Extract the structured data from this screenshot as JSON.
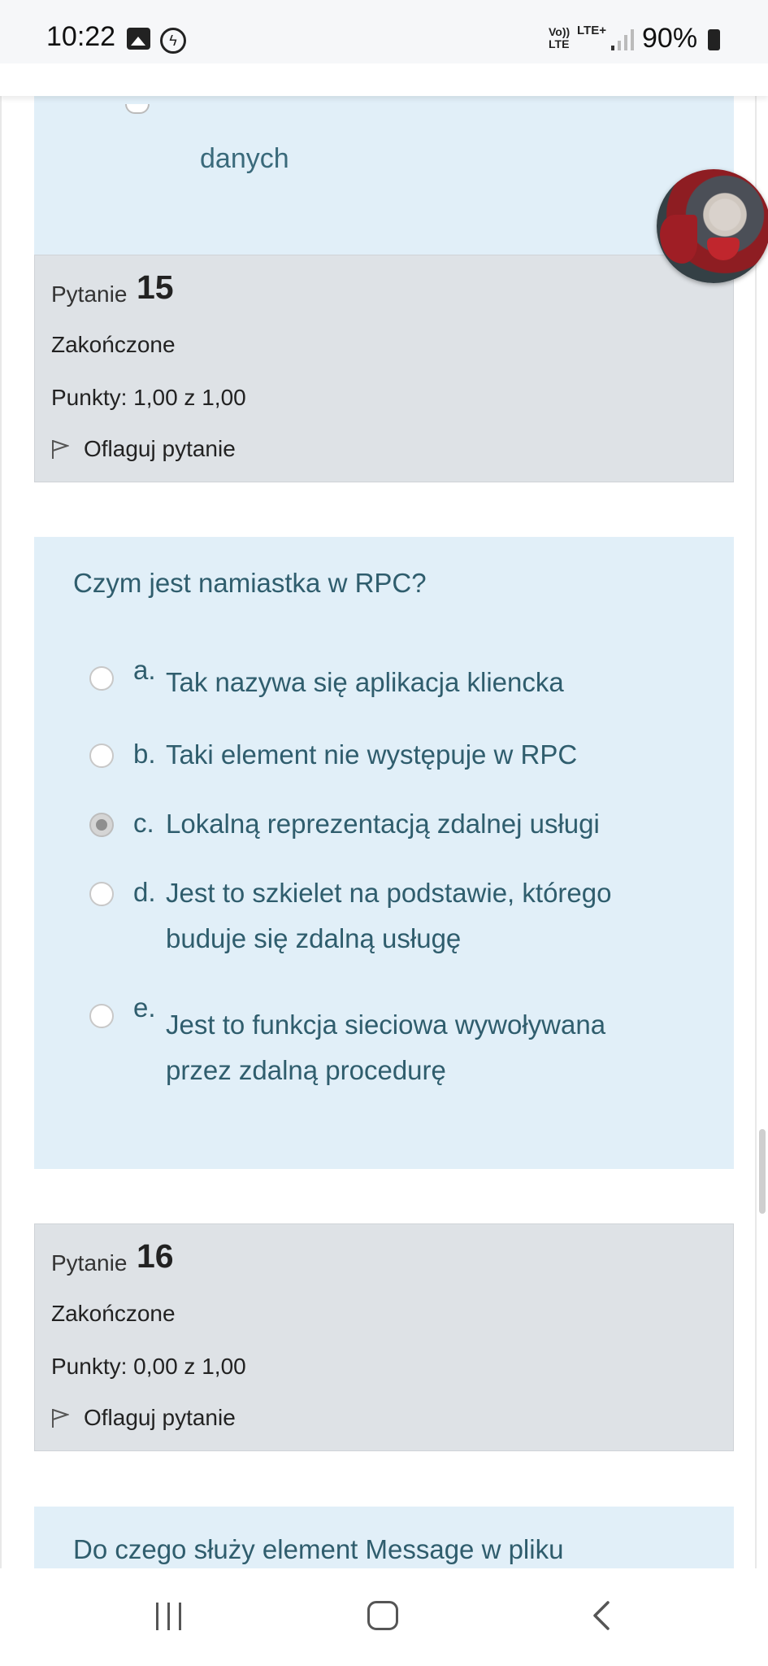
{
  "status_bar": {
    "time": "10:22",
    "notification_icons": [
      "gallery-icon",
      "messenger-icon"
    ],
    "volte": "Vo)) LTE",
    "network": "LTE+",
    "battery": "90%"
  },
  "previous_answer": {
    "text": "danych"
  },
  "q15": {
    "label": "Pytanie",
    "number": "15",
    "state": "Zakończone",
    "grade": "Punkty: 1,00 z 1,00",
    "flag": "Oflaguj pytanie",
    "question": "Czym jest namiastka w RPC?",
    "answers": [
      {
        "letter": "a.",
        "text": "Tak nazywa się aplikacja kliencka",
        "selected": false
      },
      {
        "letter": "b.",
        "text": "Taki element nie występuje w RPC",
        "selected": false
      },
      {
        "letter": "c.",
        "text": "Lokalną reprezentacją zdalnej usługi",
        "selected": true
      },
      {
        "letter": "d.",
        "text_line1": "Jest to szkielet na podstawie, którego",
        "text_line2": "buduje się zdalną usługę",
        "selected": false
      },
      {
        "letter": "e.",
        "text_line1": "Jest to funkcja sieciowa wywoływana",
        "text_line2": "przez zdalną procedurę",
        "selected": false
      }
    ]
  },
  "q16": {
    "label": "Pytanie",
    "number": "16",
    "state": "Zakończone",
    "grade": "Punkty: 0,00 z 1,00",
    "flag": "Oflaguj pytanie",
    "question_partial": "Do czego służy element Message w pliku"
  },
  "nav": {
    "icons": [
      "recent-apps-icon",
      "home-icon",
      "back-icon"
    ]
  }
}
